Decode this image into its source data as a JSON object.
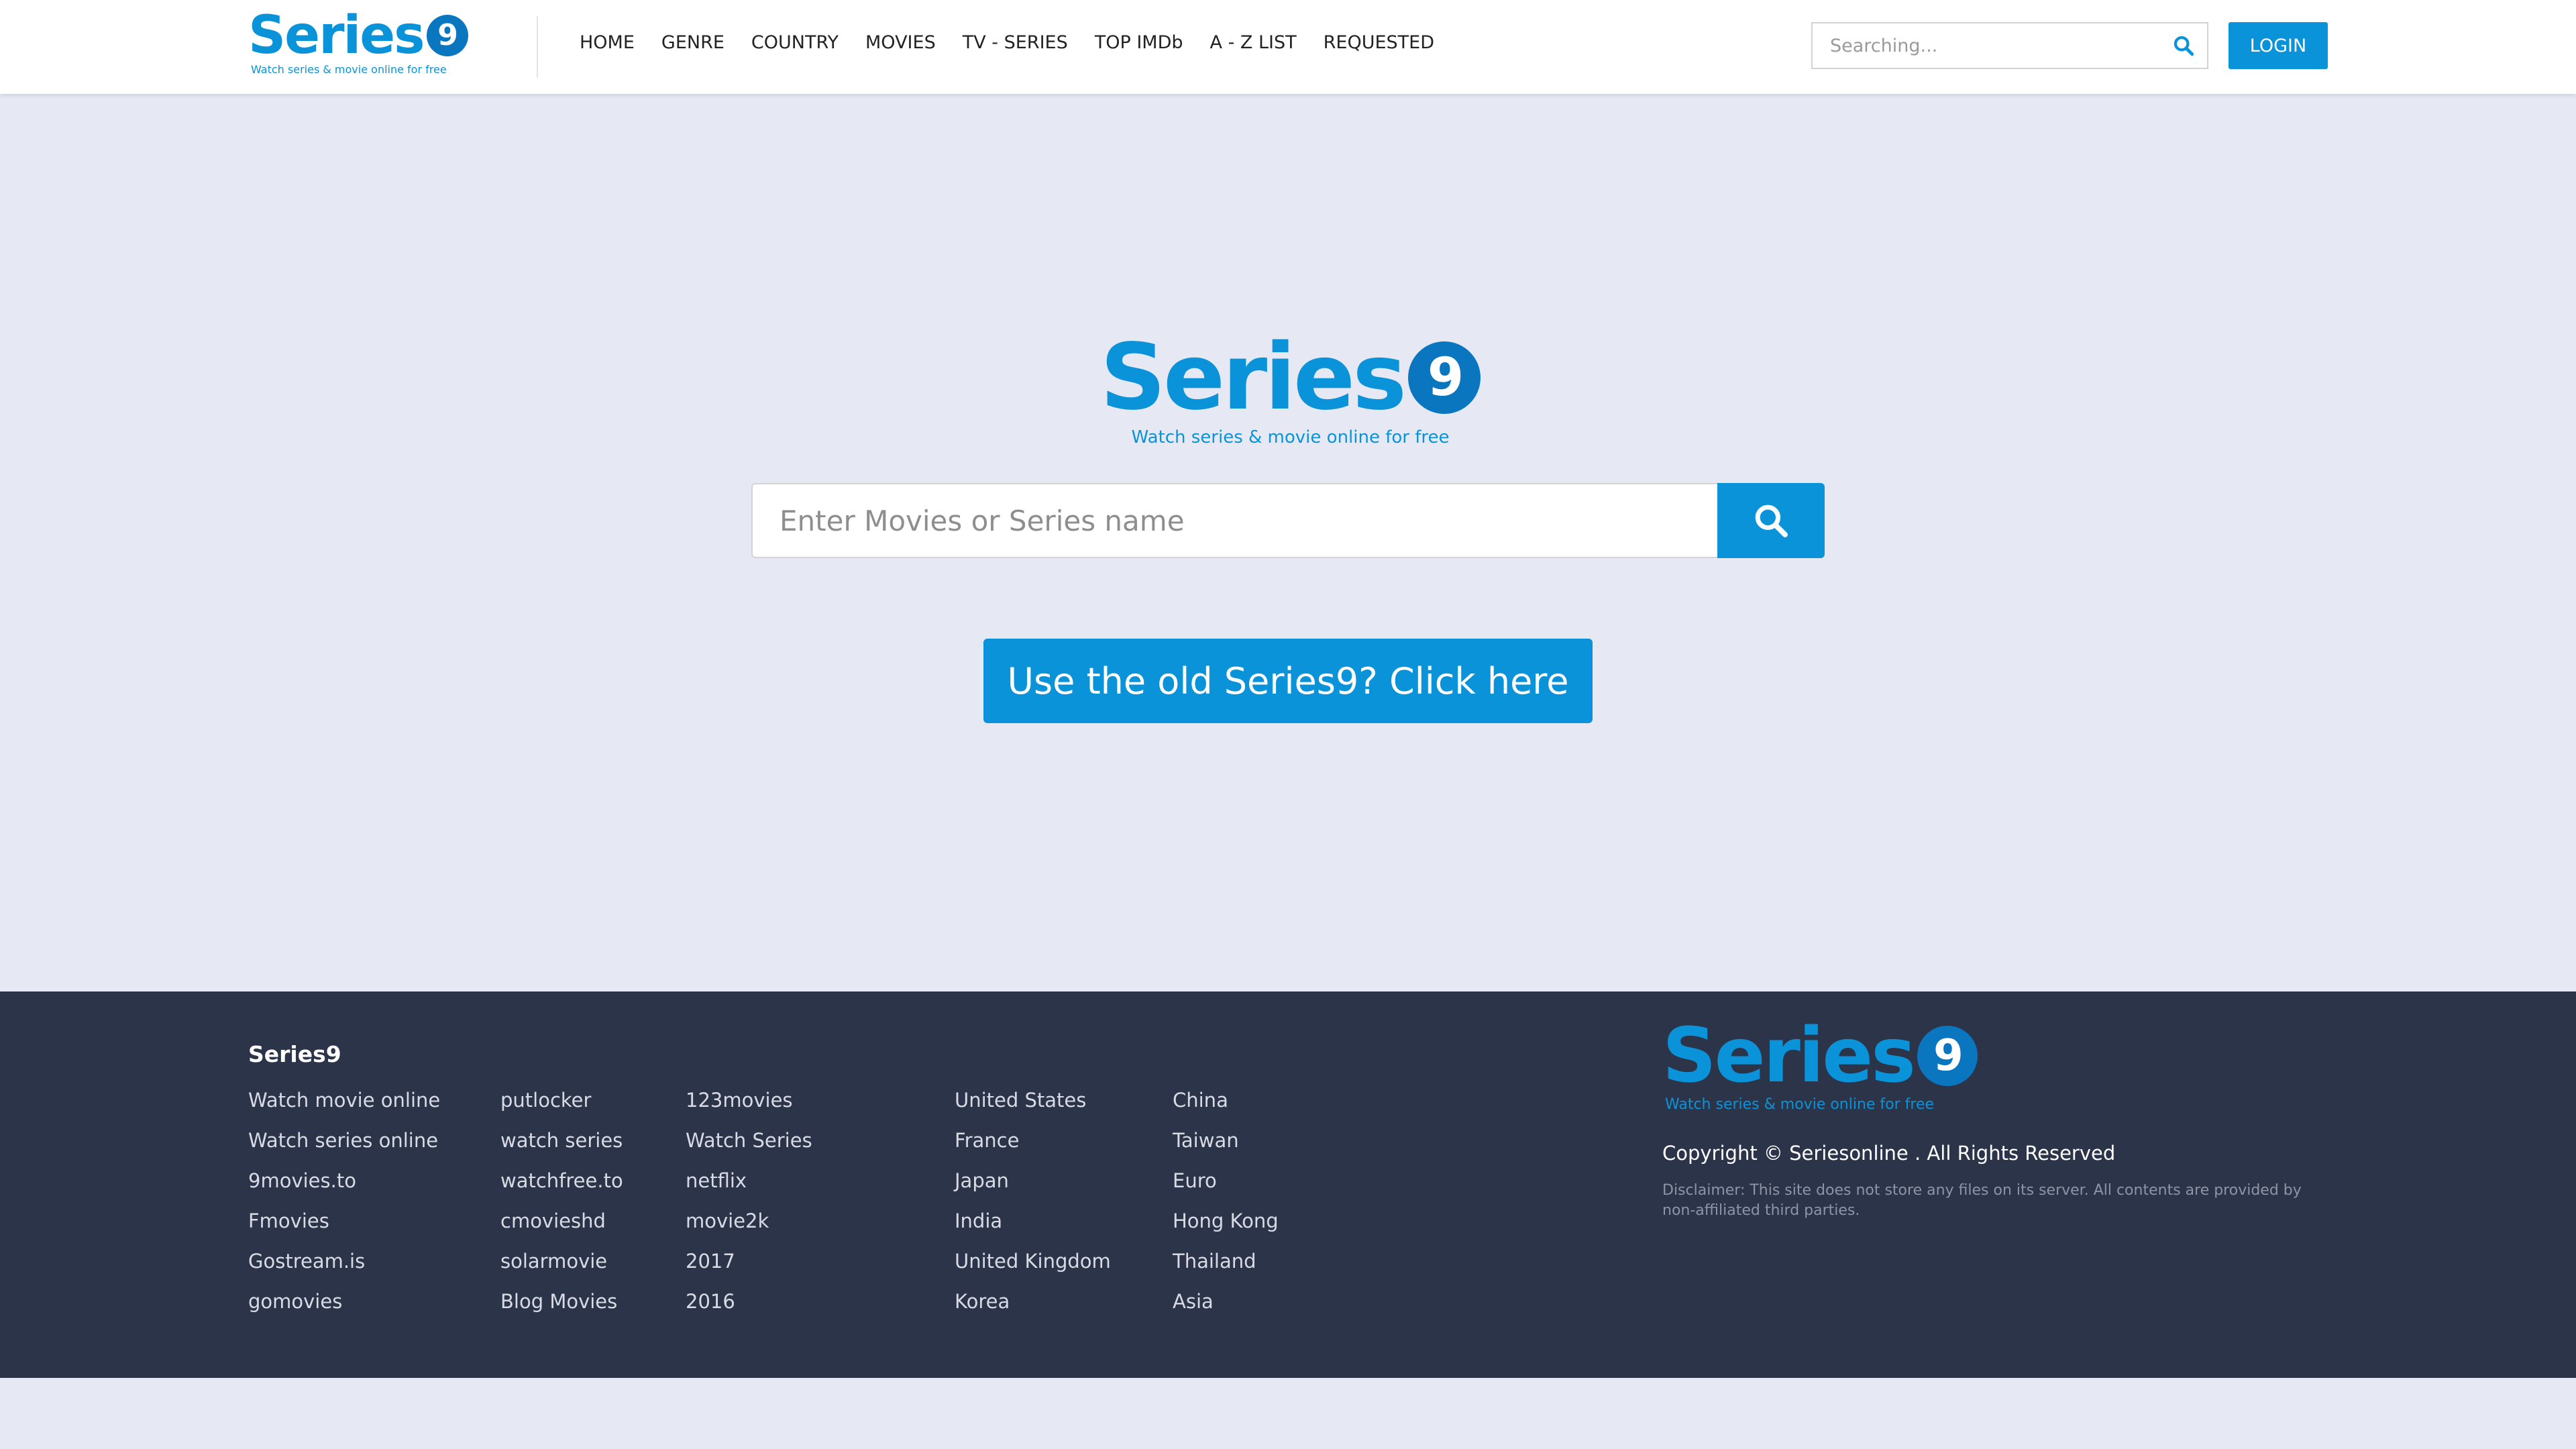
{
  "brand": {
    "name_text": "Series",
    "name_digit": "9",
    "tagline": "Watch series & movie online for free",
    "accent_color": "#0a93d8"
  },
  "header": {
    "nav": [
      "HOME",
      "GENRE",
      "COUNTRY",
      "MOVIES",
      "TV - SERIES",
      "TOP IMDb",
      "A - Z LIST",
      "REQUESTED"
    ],
    "search_placeholder": "Searching...",
    "login_label": "LOGIN"
  },
  "hero": {
    "search_placeholder": "Enter Movies or Series name",
    "old_site_label": "Use the old Series9? Click here"
  },
  "footer": {
    "title": "Series9",
    "columns": [
      [
        "Watch movie online",
        "Watch series online",
        "9movies.to",
        "Fmovies",
        "Gostream.is",
        "gomovies"
      ],
      [
        "putlocker",
        "watch series",
        "watchfree.to",
        "cmovieshd",
        "solarmovie",
        "Blog Movies"
      ],
      [
        "123movies",
        "Watch Series",
        "netflix",
        "movie2k",
        "2017",
        "2016"
      ],
      [
        "United States",
        "France",
        "Japan",
        "India",
        "United Kingdom",
        "Korea"
      ],
      [
        "China",
        "Taiwan",
        "Euro",
        "Hong Kong",
        "Thailand",
        "Asia"
      ]
    ],
    "copyright": "Copyright © Seriesonline . All Rights Reserved",
    "disclaimer": "Disclaimer: This site does not store any files on its server. All contents are provided by non-affiliated third parties."
  }
}
